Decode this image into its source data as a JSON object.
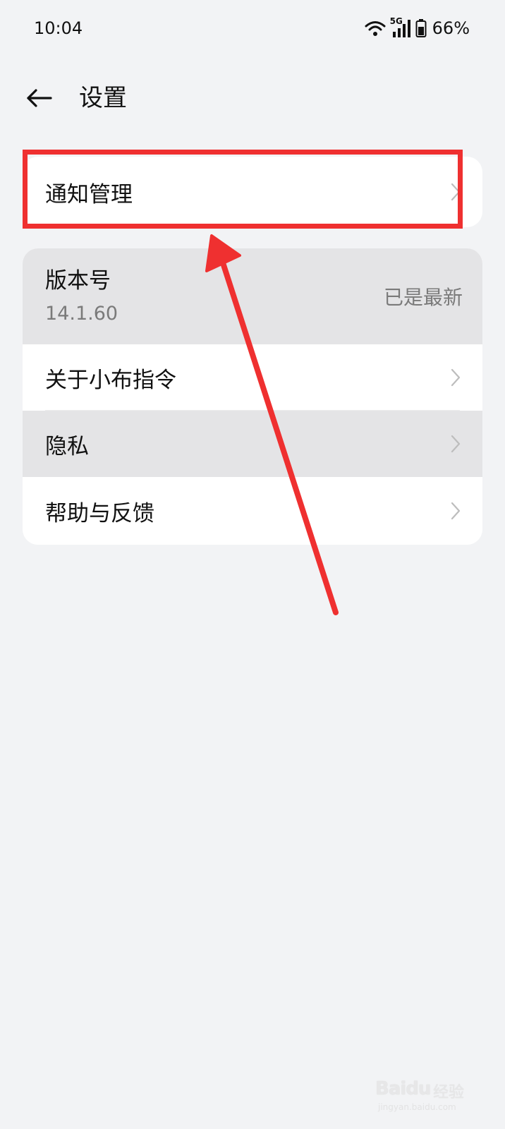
{
  "status_bar": {
    "time": "10:04",
    "network": "5G",
    "battery": "66%",
    "icons": [
      "wifi-icon",
      "signal-5g-icon",
      "battery-icon"
    ]
  },
  "header": {
    "back_icon": "arrow-left-icon",
    "title": "设置"
  },
  "notify_card": {
    "label": "通知管理",
    "icon": "chevron-right-icon"
  },
  "main_card": {
    "version": {
      "label": "版本号",
      "number": "14.1.60",
      "status": "已是最新"
    },
    "items": [
      {
        "label": "关于小布指令",
        "icon": "chevron-right-icon"
      },
      {
        "label": "隐私",
        "icon": "chevron-right-icon"
      },
      {
        "label": "帮助与反馈",
        "icon": "chevron-right-icon"
      }
    ]
  },
  "annotation": {
    "color": "#ef3030"
  },
  "watermark": {
    "logo": "Baidu",
    "text": "经验",
    "url": "jingyan.baidu.com"
  }
}
